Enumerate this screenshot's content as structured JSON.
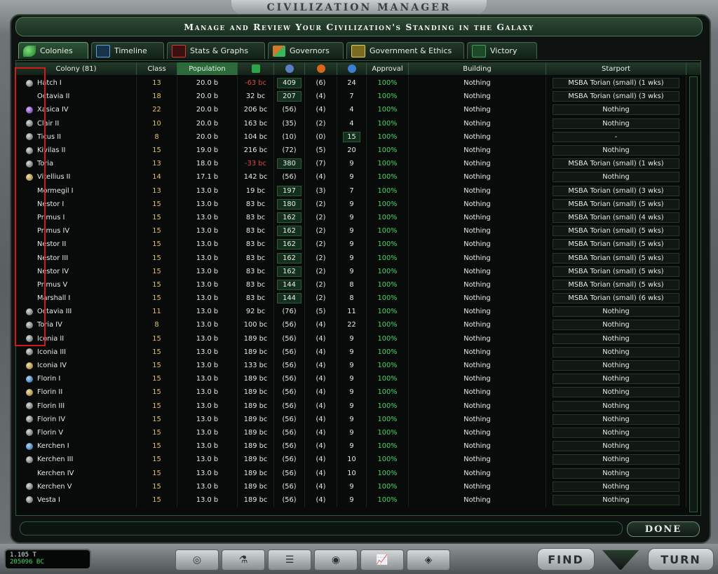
{
  "window": {
    "title": "Civilization Manager",
    "subtitle": "Manage and Review Your Civilization's Standing in the Galaxy"
  },
  "tabs": [
    {
      "label": "Colonies",
      "icon": "leaf-icon",
      "active": true
    },
    {
      "label": "Timeline",
      "icon": "line-graph-icon"
    },
    {
      "label": "Stats & Graphs",
      "icon": "bar-chart-icon"
    },
    {
      "label": "Governors",
      "icon": "arrows-icon"
    },
    {
      "label": "Government & Ethics",
      "icon": "scale-icon"
    },
    {
      "label": "Victory",
      "icon": "flag-icon"
    }
  ],
  "table": {
    "headers": {
      "colony": "Colony (81)",
      "class": "Class",
      "population": "Population",
      "income": "",
      "defense": "",
      "morale": "",
      "approval_icon": "",
      "approval": "Approval",
      "building": "Building",
      "starport": "Starport"
    },
    "header_icons": [
      "money-icon",
      "shield-icon",
      "fire-icon",
      "drop-icon"
    ],
    "rows": [
      {
        "planet": "gray",
        "name": "Hatch I",
        "class": "13",
        "pop": "20.0 b",
        "income": "-63 bc",
        "def": "409",
        "morale": "(6)",
        "growth": "24",
        "approval": "100%",
        "building": "Nothing",
        "starport": "MSBA Torian (small) (1 wks)"
      },
      {
        "planet": "none",
        "name": "Octavia II",
        "class": "18",
        "pop": "20.0 b",
        "income": "32 bc",
        "def": "207",
        "morale": "(4)",
        "growth": "7",
        "approval": "100%",
        "building": "Nothing",
        "starport": "MSBA Torian (small) (3 wks)"
      },
      {
        "planet": "purple",
        "name": "Xasica IV",
        "class": "22",
        "pop": "20.0 b",
        "income": "206 bc",
        "def": "(56)",
        "morale": "(4)",
        "growth": "4",
        "approval": "100%",
        "building": "Nothing",
        "starport": "Nothing"
      },
      {
        "planet": "gray",
        "name": "Clair II",
        "class": "10",
        "pop": "20.0 b",
        "income": "163 bc",
        "def": "(35)",
        "morale": "(2)",
        "growth": "4",
        "approval": "100%",
        "building": "Nothing",
        "starport": "Nothing"
      },
      {
        "planet": "gray",
        "name": "Ticus II",
        "class": "8",
        "pop": "20.0 b",
        "income": "104 bc",
        "def": "(10)",
        "morale": "(0)",
        "growth": "15",
        "approval": "100%",
        "building": "Nothing",
        "starport": "-"
      },
      {
        "planet": "gray",
        "name": "Kivilas II",
        "class": "15",
        "pop": "19.0 b",
        "income": "216 bc",
        "def": "(72)",
        "morale": "(5)",
        "growth": "20",
        "approval": "100%",
        "building": "Nothing",
        "starport": "Nothing"
      },
      {
        "planet": "gray",
        "name": "Toria",
        "class": "13",
        "pop": "18.0 b",
        "income": "-33 bc",
        "def": "380",
        "morale": "(7)",
        "growth": "9",
        "approval": "100%",
        "building": "Nothing",
        "starport": "MSBA Torian (small) (1 wks)"
      },
      {
        "planet": "tan",
        "name": "Vitellius II",
        "class": "14",
        "pop": "17.1 b",
        "income": "142 bc",
        "def": "(56)",
        "morale": "(4)",
        "growth": "9",
        "approval": "100%",
        "building": "Nothing",
        "starport": "Nothing"
      },
      {
        "planet": "none",
        "name": "Mormegil I",
        "class": "13",
        "pop": "13.0 b",
        "income": "19 bc",
        "def": "197",
        "morale": "(3)",
        "growth": "7",
        "approval": "100%",
        "building": "Nothing",
        "starport": "MSBA Torian (small) (3 wks)"
      },
      {
        "planet": "none",
        "name": "Nestor I",
        "class": "15",
        "pop": "13.0 b",
        "income": "83 bc",
        "def": "180",
        "morale": "(2)",
        "growth": "9",
        "approval": "100%",
        "building": "Nothing",
        "starport": "MSBA Torian (small) (5 wks)"
      },
      {
        "planet": "none",
        "name": "Primus I",
        "class": "15",
        "pop": "13.0 b",
        "income": "83 bc",
        "def": "162",
        "morale": "(2)",
        "growth": "9",
        "approval": "100%",
        "building": "Nothing",
        "starport": "MSBA Torian (small) (4 wks)"
      },
      {
        "planet": "none",
        "name": "Primus IV",
        "class": "15",
        "pop": "13.0 b",
        "income": "83 bc",
        "def": "162",
        "morale": "(2)",
        "growth": "9",
        "approval": "100%",
        "building": "Nothing",
        "starport": "MSBA Torian (small) (5 wks)"
      },
      {
        "planet": "none",
        "name": "Nestor II",
        "class": "15",
        "pop": "13.0 b",
        "income": "83 bc",
        "def": "162",
        "morale": "(2)",
        "growth": "9",
        "approval": "100%",
        "building": "Nothing",
        "starport": "MSBA Torian (small) (5 wks)"
      },
      {
        "planet": "none",
        "name": "Nestor III",
        "class": "15",
        "pop": "13.0 b",
        "income": "83 bc",
        "def": "162",
        "morale": "(2)",
        "growth": "9",
        "approval": "100%",
        "building": "Nothing",
        "starport": "MSBA Torian (small) (5 wks)"
      },
      {
        "planet": "none",
        "name": "Nestor IV",
        "class": "15",
        "pop": "13.0 b",
        "income": "83 bc",
        "def": "162",
        "morale": "(2)",
        "growth": "9",
        "approval": "100%",
        "building": "Nothing",
        "starport": "MSBA Torian (small) (5 wks)"
      },
      {
        "planet": "none",
        "name": "Primus V",
        "class": "15",
        "pop": "13.0 b",
        "income": "83 bc",
        "def": "144",
        "morale": "(2)",
        "growth": "8",
        "approval": "100%",
        "building": "Nothing",
        "starport": "MSBA Torian (small) (5 wks)"
      },
      {
        "planet": "none",
        "name": "Marshall I",
        "class": "15",
        "pop": "13.0 b",
        "income": "83 bc",
        "def": "144",
        "morale": "(2)",
        "growth": "8",
        "approval": "100%",
        "building": "Nothing",
        "starport": "MSBA Torian (small) (6 wks)"
      },
      {
        "planet": "gray",
        "name": "Octavia III",
        "class": "11",
        "pop": "13.0 b",
        "income": "92 bc",
        "def": "(76)",
        "morale": "(5)",
        "growth": "11",
        "approval": "100%",
        "building": "Nothing",
        "starport": "Nothing"
      },
      {
        "planet": "gray",
        "name": "Toria IV",
        "class": "8",
        "pop": "13.0 b",
        "income": "100 bc",
        "def": "(56)",
        "morale": "(4)",
        "growth": "22",
        "approval": "100%",
        "building": "Nothing",
        "starport": "Nothing"
      },
      {
        "planet": "gray",
        "name": "Iconia II",
        "class": "15",
        "pop": "13.0 b",
        "income": "189 bc",
        "def": "(56)",
        "morale": "(4)",
        "growth": "9",
        "approval": "100%",
        "building": "Nothing",
        "starport": "Nothing"
      },
      {
        "planet": "gray",
        "name": "Iconia III",
        "class": "15",
        "pop": "13.0 b",
        "income": "189 bc",
        "def": "(56)",
        "morale": "(4)",
        "growth": "9",
        "approval": "100%",
        "building": "Nothing",
        "starport": "Nothing"
      },
      {
        "planet": "tan",
        "name": "Iconia IV",
        "class": "15",
        "pop": "13.0 b",
        "income": "133 bc",
        "def": "(56)",
        "morale": "(4)",
        "growth": "9",
        "approval": "100%",
        "building": "Nothing",
        "starport": "Nothing"
      },
      {
        "planet": "blue",
        "name": "Florin I",
        "class": "15",
        "pop": "13.0 b",
        "income": "189 bc",
        "def": "(56)",
        "morale": "(4)",
        "growth": "9",
        "approval": "100%",
        "building": "Nothing",
        "starport": "Nothing"
      },
      {
        "planet": "tan",
        "name": "Florin II",
        "class": "15",
        "pop": "13.0 b",
        "income": "189 bc",
        "def": "(56)",
        "morale": "(4)",
        "growth": "9",
        "approval": "100%",
        "building": "Nothing",
        "starport": "Nothing"
      },
      {
        "planet": "gray",
        "name": "Florin III",
        "class": "15",
        "pop": "13.0 b",
        "income": "189 bc",
        "def": "(56)",
        "morale": "(4)",
        "growth": "9",
        "approval": "100%",
        "building": "Nothing",
        "starport": "Nothing"
      },
      {
        "planet": "gray",
        "name": "Florin IV",
        "class": "15",
        "pop": "13.0 b",
        "income": "189 bc",
        "def": "(56)",
        "morale": "(4)",
        "growth": "9",
        "approval": "100%",
        "building": "Nothing",
        "starport": "Nothing"
      },
      {
        "planet": "gray",
        "name": "Florin V",
        "class": "15",
        "pop": "13.0 b",
        "income": "189 bc",
        "def": "(56)",
        "morale": "(4)",
        "growth": "9",
        "approval": "100%",
        "building": "Nothing",
        "starport": "Nothing"
      },
      {
        "planet": "blue",
        "name": "Kerchen I",
        "class": "15",
        "pop": "13.0 b",
        "income": "189 bc",
        "def": "(56)",
        "morale": "(4)",
        "growth": "9",
        "approval": "100%",
        "building": "Nothing",
        "starport": "Nothing"
      },
      {
        "planet": "gray",
        "name": "Kerchen III",
        "class": "15",
        "pop": "13.0 b",
        "income": "189 bc",
        "def": "(56)",
        "morale": "(4)",
        "growth": "10",
        "approval": "100%",
        "building": "Nothing",
        "starport": "Nothing"
      },
      {
        "planet": "none",
        "name": "Kerchen IV",
        "class": "15",
        "pop": "13.0 b",
        "income": "189 bc",
        "def": "(56)",
        "morale": "(4)",
        "growth": "10",
        "approval": "100%",
        "building": "Nothing",
        "starport": "Nothing"
      },
      {
        "planet": "gray",
        "name": "Kerchen V",
        "class": "15",
        "pop": "13.0 b",
        "income": "189 bc",
        "def": "(56)",
        "morale": "(4)",
        "growth": "9",
        "approval": "100%",
        "building": "Nothing",
        "starport": "Nothing"
      },
      {
        "planet": "gray",
        "name": "Vesta I",
        "class": "15",
        "pop": "13.0 b",
        "income": "189 bc",
        "def": "(56)",
        "morale": "(4)",
        "growth": "9",
        "approval": "100%",
        "building": "Nothing",
        "starport": "Nothing"
      }
    ]
  },
  "footer": {
    "done_label": "Done",
    "stats_line1": "1.105 T",
    "stats_line2": "205096 BC",
    "find_label": "Find",
    "turn_label": "Turn",
    "control_icons": [
      "planet-icon",
      "flask-icon",
      "document-icon",
      "galaxy-icon",
      "graph-icon",
      "diplomacy-icon"
    ]
  }
}
